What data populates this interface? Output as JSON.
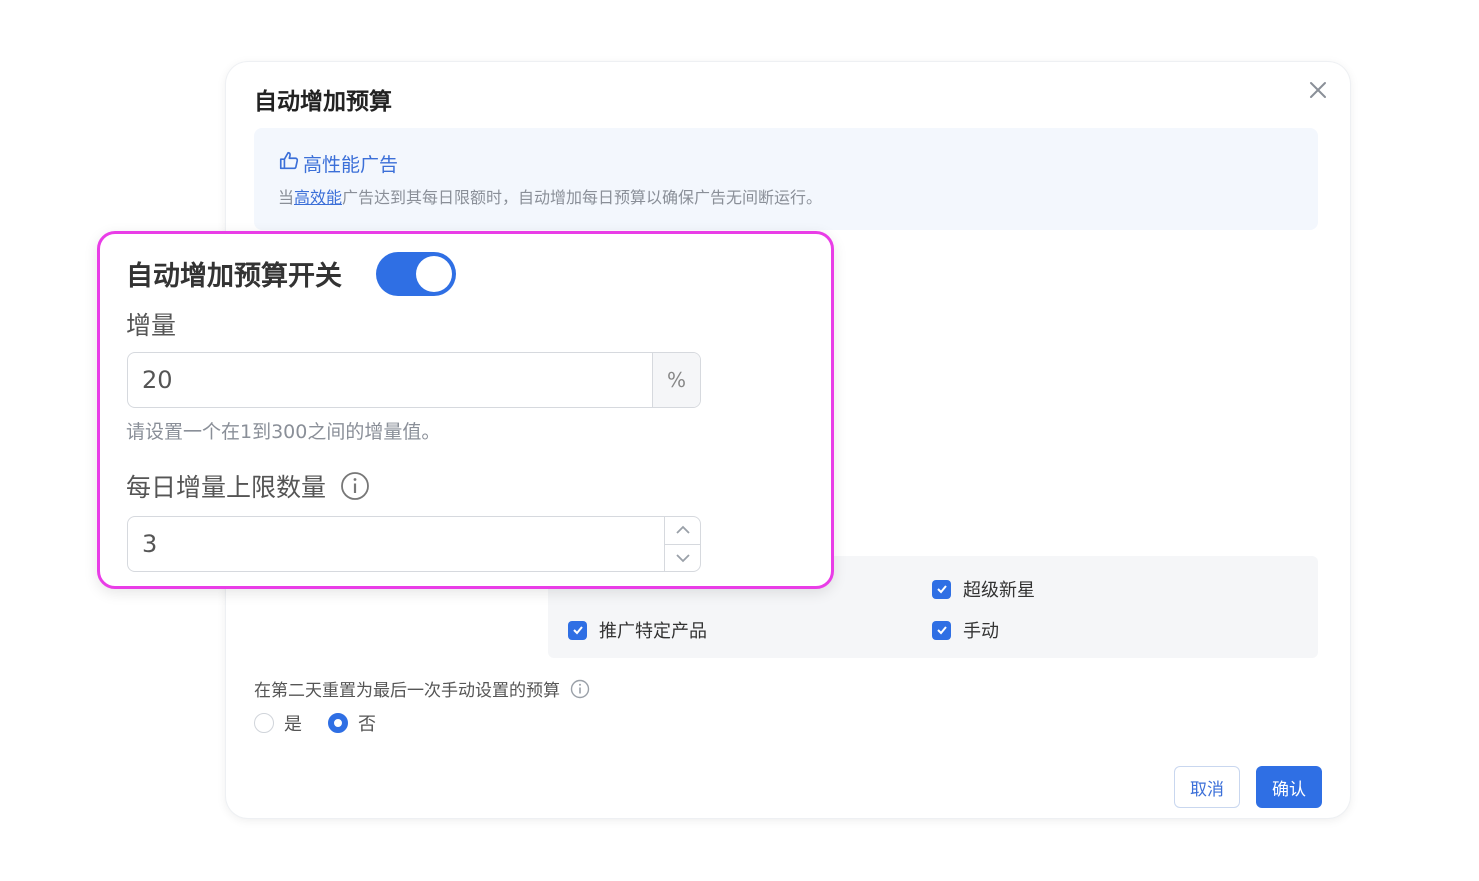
{
  "dialog": {
    "title": "自动增加预算",
    "close_icon": "close-icon"
  },
  "info": {
    "icon": "thumbs-up-icon",
    "heading": "高性能广告",
    "desc_prefix": "当",
    "desc_link": "高效能",
    "desc_suffix": "广告达到其每日限额时，自动增加每日预算以确保广告无间断运行。"
  },
  "focus": {
    "switch_label": "自动增加预算开关",
    "switch_on": true,
    "increment_label": "增量",
    "increment_value": "20",
    "increment_suffix": "%",
    "increment_hint": "请设置一个在1到300之间的增量值。",
    "daily_limit_label": "每日增量上限数量",
    "daily_limit_value": "3"
  },
  "checkboxes": [
    {
      "label": "超级新星",
      "checked": true
    },
    {
      "label": "推广特定产品",
      "checked": true
    },
    {
      "label": "手动",
      "checked": true
    }
  ],
  "reset": {
    "label": "在第二天重置为最后一次手动设置的预算",
    "options": [
      "是",
      "否"
    ],
    "selected": "否"
  },
  "buttons": {
    "cancel": "取消",
    "confirm": "确认"
  },
  "colors": {
    "accent": "#2f6fe4",
    "highlight_border": "#e93de7",
    "link": "#3b6fd8"
  }
}
